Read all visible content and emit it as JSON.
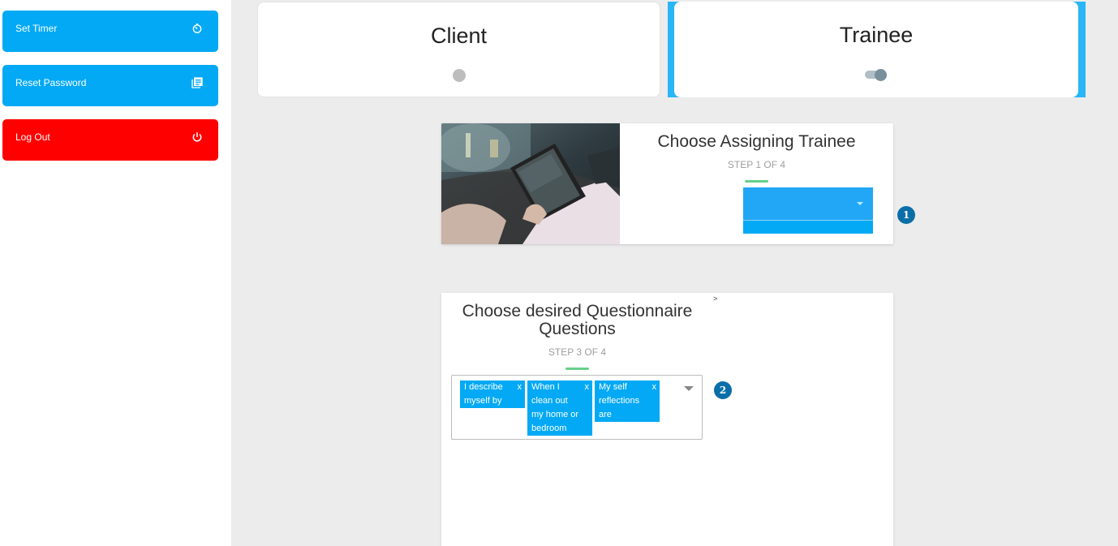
{
  "sidebar": {
    "items": [
      {
        "label": "Set Timer",
        "icon": "timer-icon"
      },
      {
        "label": "Reset Password",
        "icon": "library-books-icon"
      },
      {
        "label": "Log Out",
        "icon": "power-icon"
      }
    ]
  },
  "role_toggle": {
    "client_label": "Client",
    "trainee_label": "Trainee",
    "active": "Trainee"
  },
  "step1": {
    "title": "Choose Assigning Trainee",
    "step_text": "STEP 1 OF 4",
    "select_value": "",
    "badge": "1"
  },
  "step3": {
    "title_line1": "Choose desired Questionnaire",
    "title_line2": "Questions",
    "step_text": "STEP 3 OF 4",
    "stray_text": ">",
    "chips": [
      {
        "label": "I describe myself by",
        "remove": "x"
      },
      {
        "label": "When I clean out my home or bedroom",
        "remove": "x"
      },
      {
        "label": "My self reflections are",
        "remove": "x"
      }
    ],
    "badge": "2"
  },
  "colors": {
    "primary": "#03a9f4",
    "danger": "#ff0000",
    "accent_bar": "#66d08a",
    "badge": "#0a6fa8"
  }
}
